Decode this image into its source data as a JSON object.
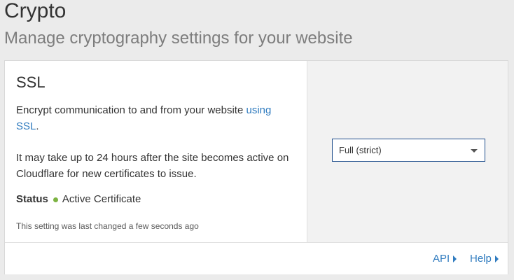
{
  "header": {
    "title": "Crypto",
    "subtitle": "Manage cryptography settings for your website"
  },
  "ssl_card": {
    "title": "SSL",
    "description_text": "Encrypt communication to and from your website ",
    "description_link": "using SSL",
    "description_end": ".",
    "note": "It may take up to 24 hours after the site becomes active on Cloudflare for new certificates to issue.",
    "status_label": "Status",
    "status_value": "Active Certificate",
    "status_color": "#7cb342",
    "last_changed": "This setting was last changed a few seconds ago",
    "mode_select": {
      "selected": "Full (strict)"
    }
  },
  "footer": {
    "api_label": "API",
    "help_label": "Help"
  },
  "colors": {
    "link": "#2f7bbf",
    "background": "#ebebeb",
    "select_border": "#1f4e8c"
  }
}
